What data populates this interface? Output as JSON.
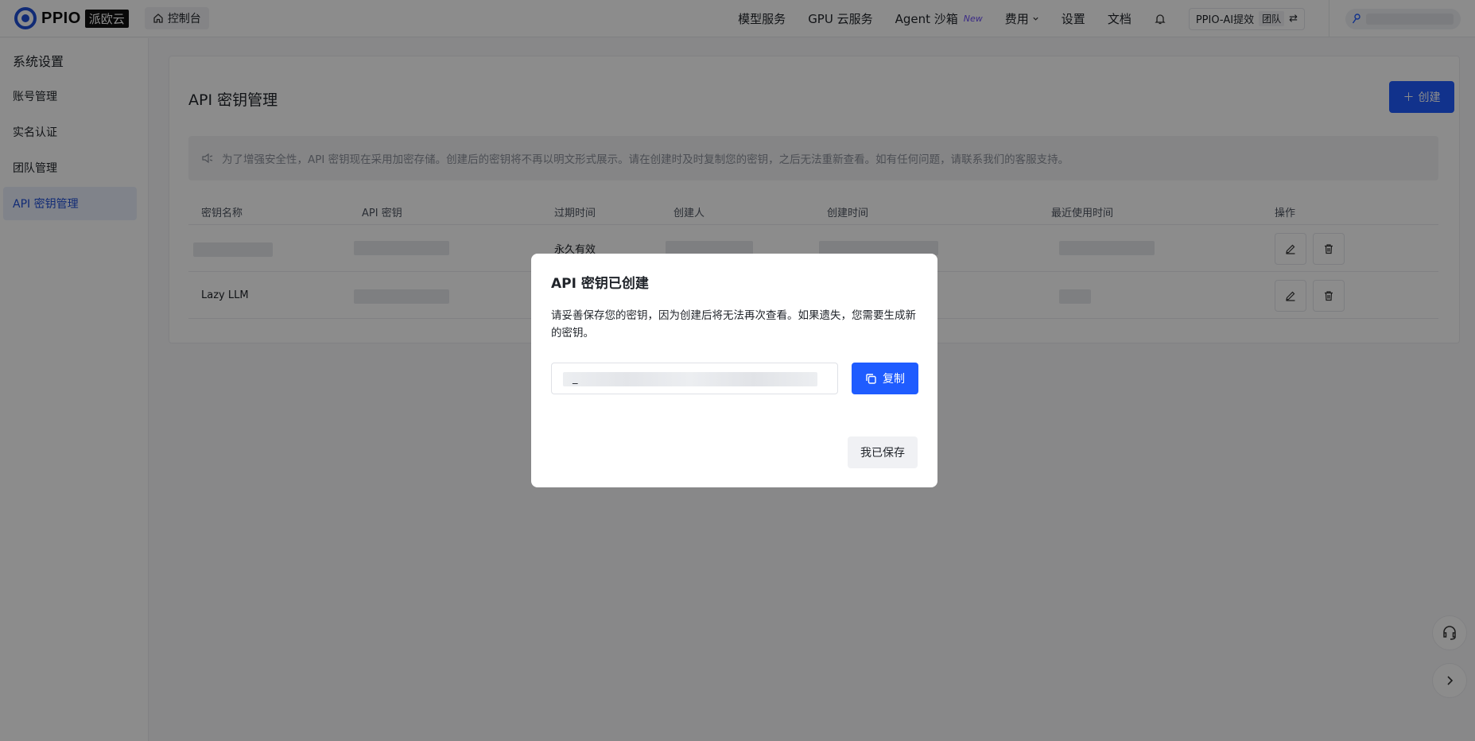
{
  "topbar": {
    "logo_text": "PPIO",
    "logo_cn": "派欧云",
    "console_label": "控制台",
    "nav": {
      "model_service": "模型服务",
      "gpu_service": "GPU 云服务",
      "agent_sandbox": "Agent 沙箱",
      "new_badge": "New",
      "billing": "费用",
      "settings": "设置",
      "docs": "文档"
    },
    "team_name": "PPIO-AI提效",
    "team_tag": "团队"
  },
  "sidebar": {
    "title": "系统设置",
    "items": [
      {
        "label": "账号管理"
      },
      {
        "label": "实名认证"
      },
      {
        "label": "团队管理"
      },
      {
        "label": "API 密钥管理"
      }
    ]
  },
  "main": {
    "title": "API 密钥管理",
    "create_label": "创建",
    "notice": "为了增强安全性，API 密钥现在采用加密存储。创建后的密钥将不再以明文形式展示。请在创建时及时复制您的密钥，之后无法重新查看。如有任何问题，请联系我们的客服支持。",
    "table": {
      "headers": [
        "密钥名称",
        "API 密钥",
        "过期时间",
        "创建人",
        "创建时间",
        "最近使用时间",
        "操作"
      ],
      "rows": [
        {
          "name": "",
          "expiry": "永久有效"
        },
        {
          "name": "Lazy LLM",
          "expiry": ""
        }
      ]
    }
  },
  "modal": {
    "title": "API 密钥已创建",
    "description": "请妥善保存您的密钥，因为创建后将无法再次查看。如果遗失，您需要生成新的密钥。",
    "key_prefix": "_",
    "copy_label": "复制",
    "saved_label": "我已保存"
  },
  "colors": {
    "primary": "#1f5cff",
    "overlay": "rgba(0,0,0,0.45)"
  }
}
